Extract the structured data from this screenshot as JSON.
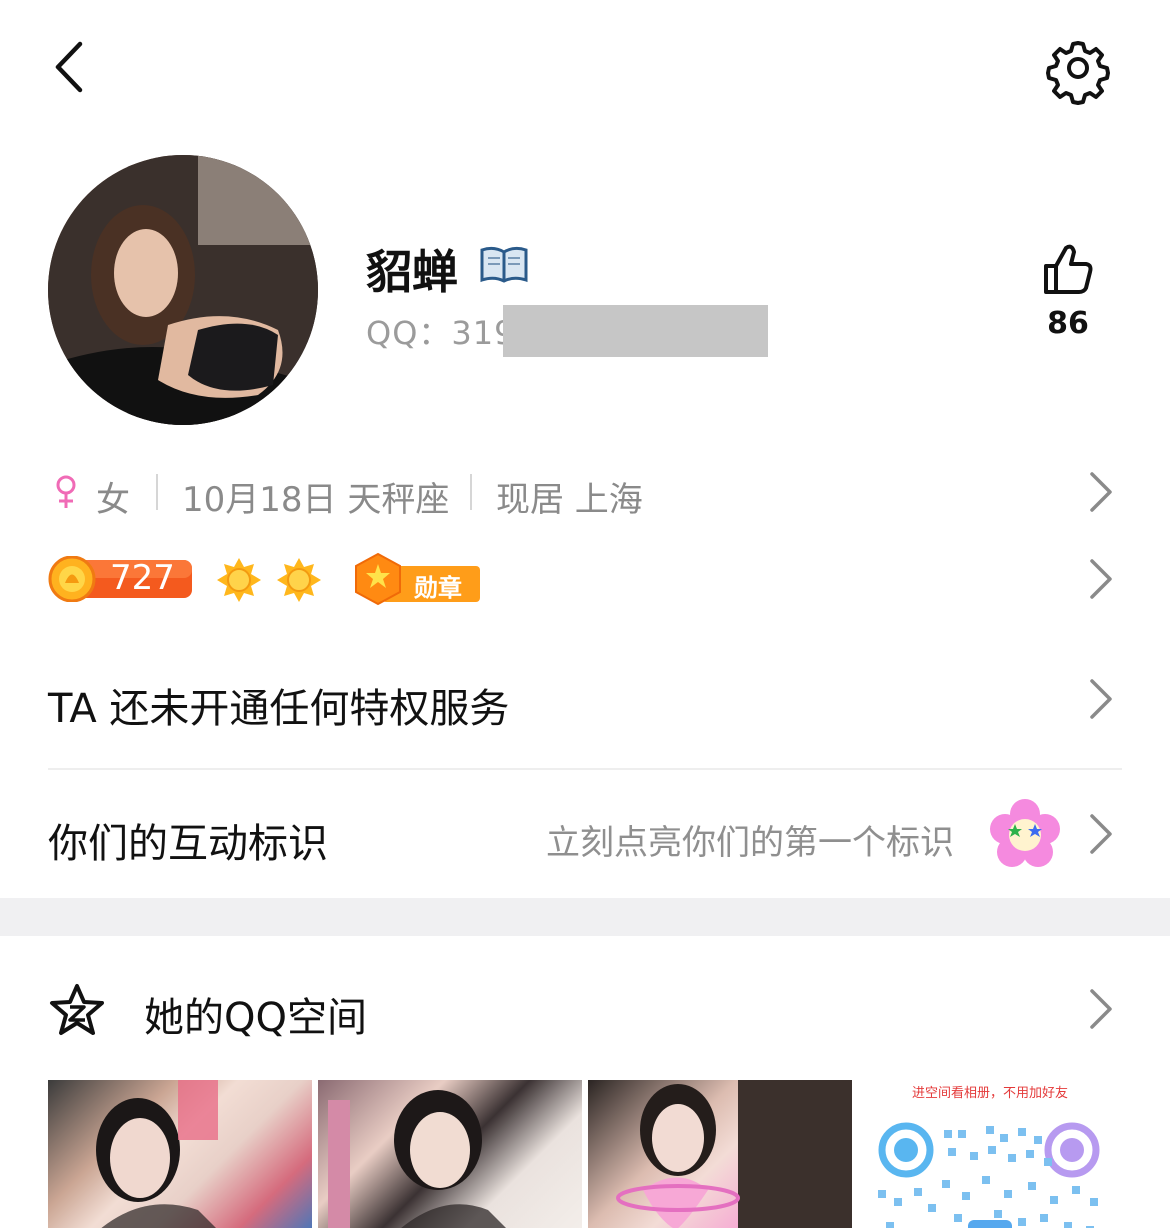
{
  "profile": {
    "nickname": "貂蝉",
    "qq_label": "QQ：319",
    "like_count": "86",
    "gender": "女",
    "birthday": "10月18日 天秤座",
    "location": "现居 上海",
    "level": "727",
    "medal_label": "勋章"
  },
  "privilege": {
    "text": "TA 还未开通任何特权服务"
  },
  "interaction": {
    "title": "你们的互动标识",
    "hint": "立刻点亮你们的第一个标识"
  },
  "qzone": {
    "title": "她的QQ空间",
    "qr_caption": "进空间看相册，不用加好友"
  },
  "colors": {
    "accent_pink": "#f06bb6",
    "level_orange": "#f45a1e",
    "medal_orange": "#ff9d19",
    "divider": "#eeeeee"
  },
  "icons": {
    "back": "chevron-left-icon",
    "settings": "gear-icon",
    "like": "thumbs-up-icon",
    "gender": "female-icon",
    "chevron": "chevron-right-icon",
    "qzone": "qzone-star-icon"
  }
}
